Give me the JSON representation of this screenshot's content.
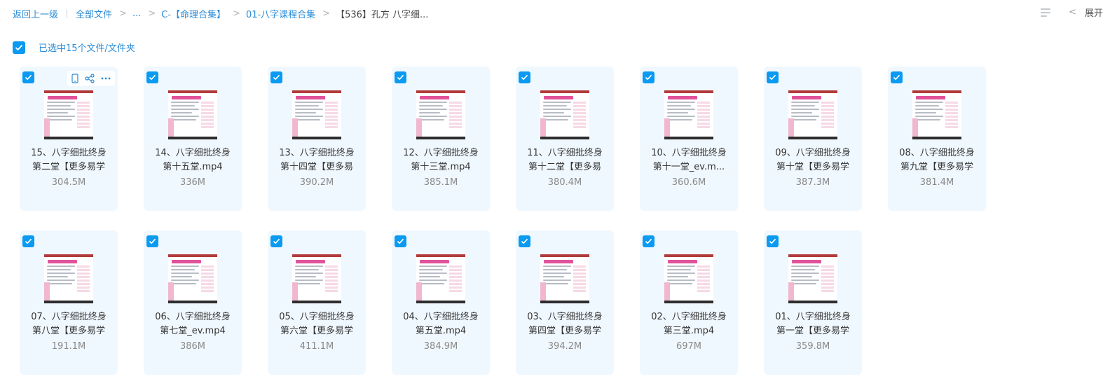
{
  "breadcrumb": {
    "back": "返回上一级",
    "items": [
      "全部文件",
      "...",
      "C-【命理合集】",
      "01-八字课程合集"
    ],
    "current": "【536】孔方 八字细...",
    "separator": ">"
  },
  "toolbar": {
    "expand_label": "展开",
    "chevron": "<"
  },
  "selection": {
    "label": "已选中15个文件/文件夹"
  },
  "colors": {
    "accent": "#0a9af1",
    "card_bg": "#f0f8ff",
    "link": "#2a8bd6"
  },
  "files": [
    {
      "line1": "15、八字细批终身",
      "line2": "第二堂【更多易学",
      "size": "304.5M"
    },
    {
      "line1": "14、八字细批终身",
      "line2": "第十五堂.mp4",
      "size": "336M"
    },
    {
      "line1": "13、八字细批终身",
      "line2": "第十四堂【更多易",
      "size": "390.2M"
    },
    {
      "line1": "12、八字细批终身",
      "line2": "第十三堂.mp4",
      "size": "385.1M"
    },
    {
      "line1": "11、八字细批终身",
      "line2": "第十二堂【更多易",
      "size": "380.4M"
    },
    {
      "line1": "10、八字细批终身",
      "line2": "第十一堂_ev.m...",
      "size": "360.6M"
    },
    {
      "line1": "09、八字细批终身",
      "line2": "第十堂【更多易学",
      "size": "387.3M"
    },
    {
      "line1": "08、八字细批终身",
      "line2": "第九堂【更多易学",
      "size": "381.4M"
    },
    {
      "line1": "07、八字细批终身",
      "line2": "第八堂【更多易学",
      "size": "191.1M"
    },
    {
      "line1": "06、八字细批终身",
      "line2": "第七堂_ev.mp4",
      "size": "386M"
    },
    {
      "line1": "05、八字细批终身",
      "line2": "第六堂【更多易学",
      "size": "411.1M"
    },
    {
      "line1": "04、八字细批终身",
      "line2": "第五堂.mp4",
      "size": "384.9M"
    },
    {
      "line1": "03、八字细批终身",
      "line2": "第四堂【更多易学",
      "size": "394.2M"
    },
    {
      "line1": "02、八字细批终身",
      "line2": "第三堂.mp4",
      "size": "697M"
    },
    {
      "line1": "01、八字细批终身",
      "line2": "第一堂【更多易学",
      "size": "359.8M"
    }
  ]
}
